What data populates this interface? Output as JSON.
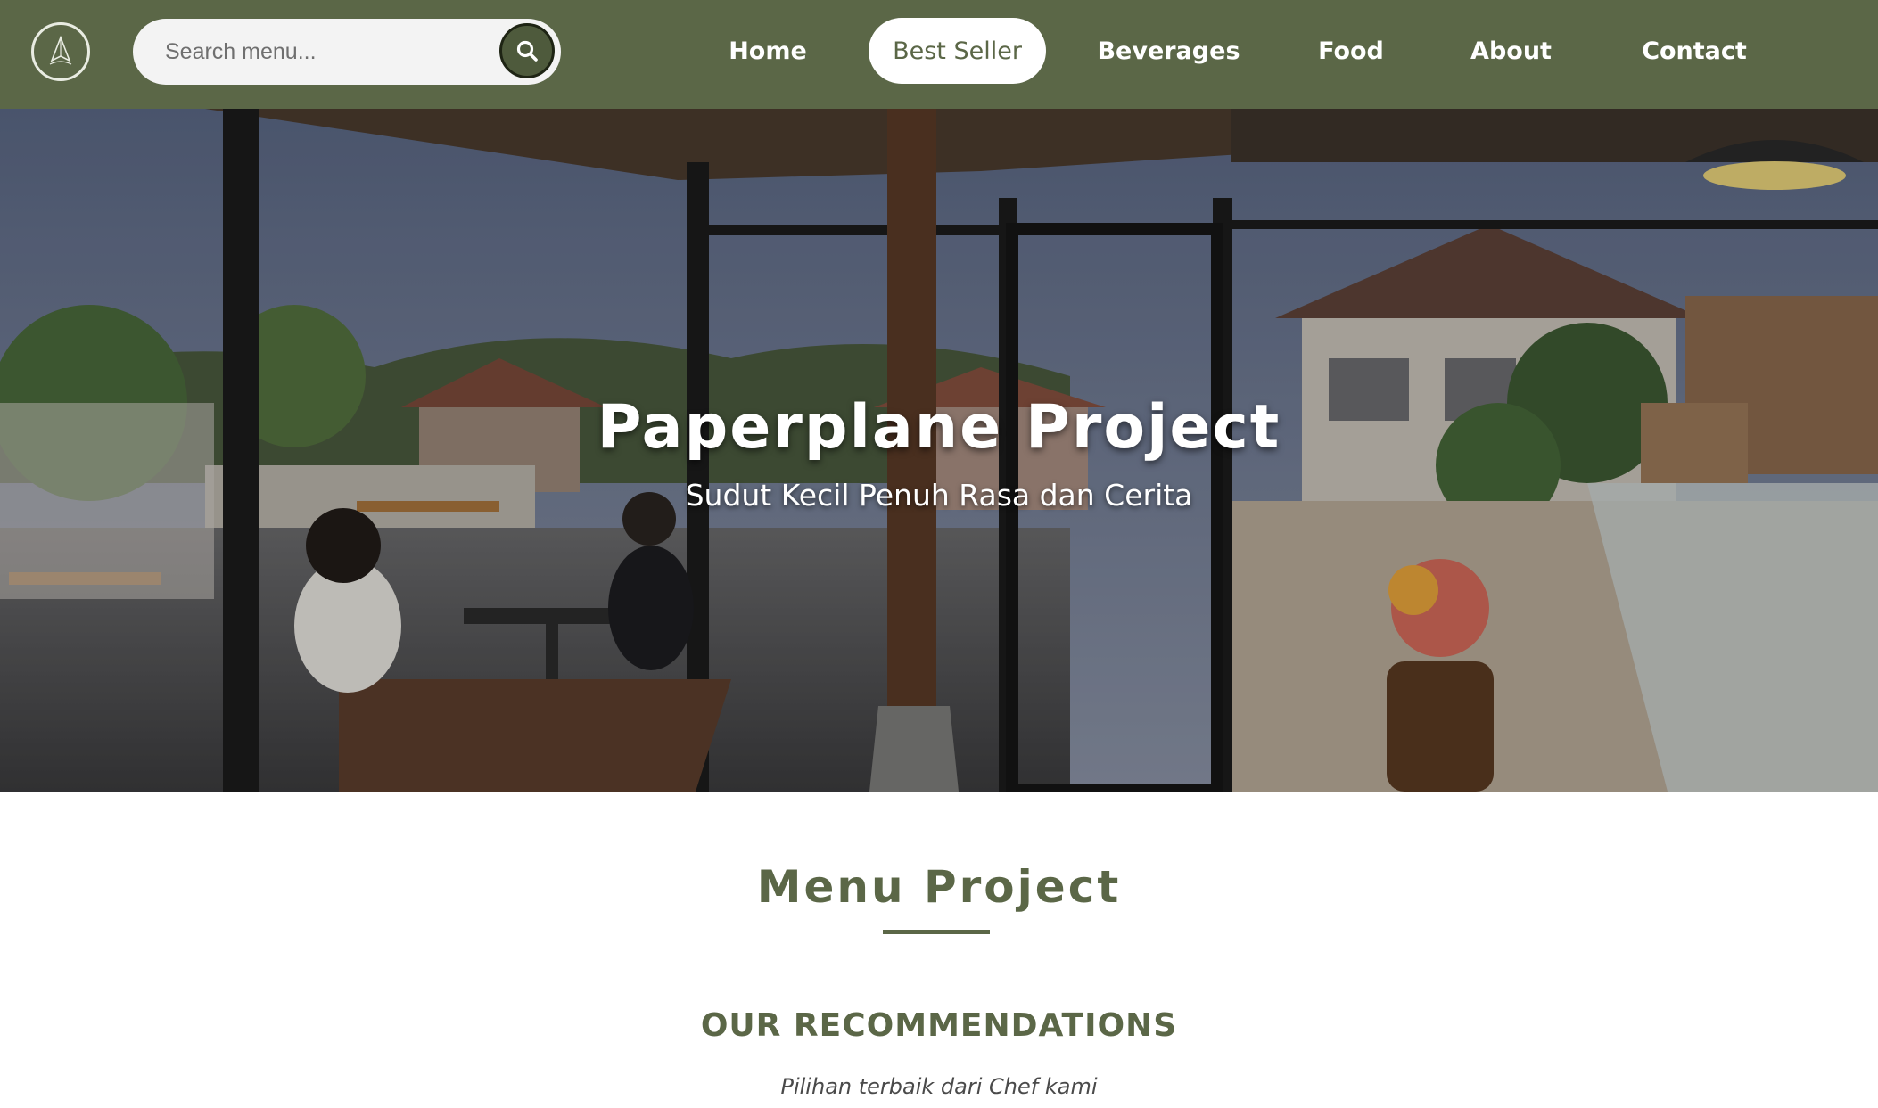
{
  "nav": {
    "search_placeholder": "Search menu...",
    "links": [
      {
        "label": "Home",
        "active": false
      },
      {
        "label": "Best Seller",
        "active": true
      },
      {
        "label": "Beverages",
        "active": false
      },
      {
        "label": "Food",
        "active": false
      },
      {
        "label": "About",
        "active": false
      },
      {
        "label": "Contact",
        "active": false
      }
    ],
    "logo_icon": "paperplane-icon",
    "search_icon": "search-icon"
  },
  "hero": {
    "title": "Paperplane Project",
    "subtitle": "Sudut Kecil Penuh Rasa dan Cerita",
    "image": "cafe-interior-photo"
  },
  "menu_section": {
    "title": "Menu Project",
    "recommendations_title": "OUR RECOMMENDATIONS",
    "recommendations_subtitle": "Pilihan terbaik dari Chef kami"
  },
  "colors": {
    "brand_green": "#5b6747",
    "white": "#ffffff",
    "search_bg": "#f3f3f3"
  }
}
